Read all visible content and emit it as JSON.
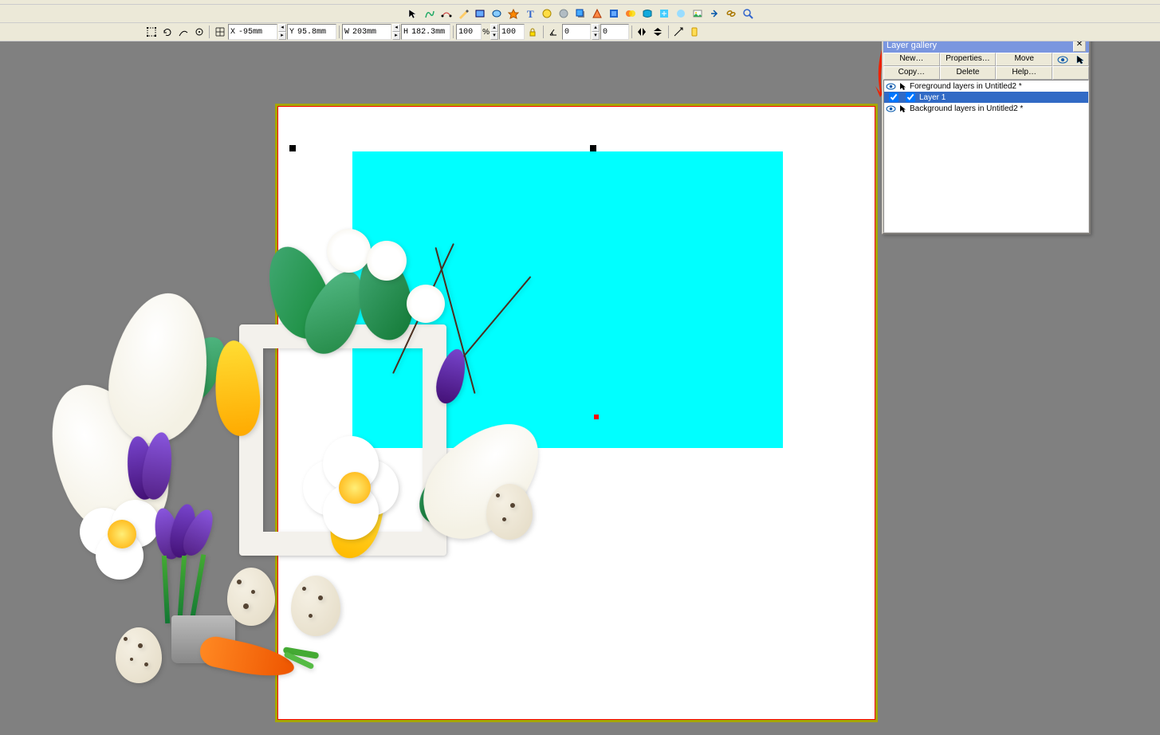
{
  "toolbar2": {
    "x_lbl": "X",
    "x_val": "-95mm",
    "y_lbl": "Y",
    "y_val": "95.8mm",
    "w_lbl": "W",
    "w_val": "203mm",
    "h_lbl": "H",
    "h_val": "182.3mm",
    "pct1": "100",
    "pct2": "100",
    "rot_lbl": "",
    "rot_val": "0",
    "skew_lbl": "",
    "skew_val": "0"
  },
  "layer_panel": {
    "title": "Layer gallery",
    "btns": {
      "new": "New…",
      "props": "Properties…",
      "move": "Move",
      "copy": "Copy…",
      "del": "Delete",
      "help": "Help…"
    },
    "rows": [
      {
        "label": "Foreground layers in Untitled2 *",
        "sel": false,
        "header": true
      },
      {
        "label": "Layer 1",
        "sel": true,
        "header": false
      },
      {
        "label": "Background layers in Untitled2 *",
        "sel": false,
        "header": true
      }
    ]
  }
}
